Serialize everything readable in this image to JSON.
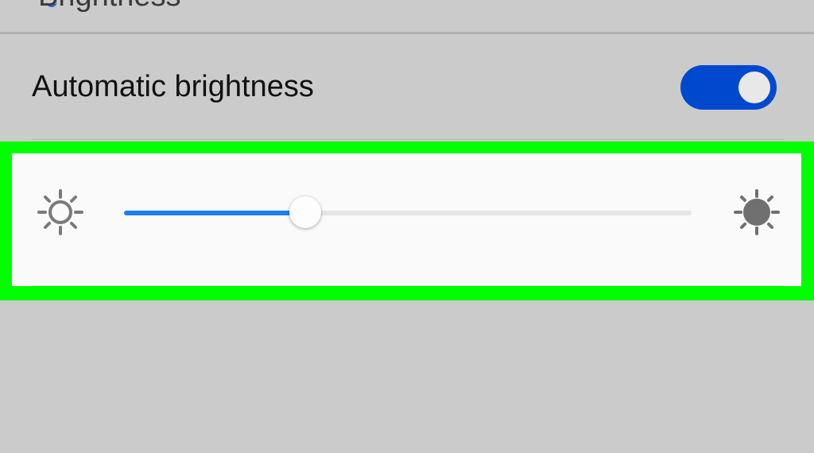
{
  "header": {
    "partial_title": "Brightness"
  },
  "automatic_brightness": {
    "label": "Automatic brightness",
    "enabled": true,
    "toggle_color": "#0049cf"
  },
  "brightness_slider": {
    "level": 0.32,
    "fill_color": "#1e7df2",
    "min_icon": "sun-outline-icon",
    "max_icon": "sun-filled-icon"
  },
  "highlight": {
    "color": "#00ff00"
  }
}
